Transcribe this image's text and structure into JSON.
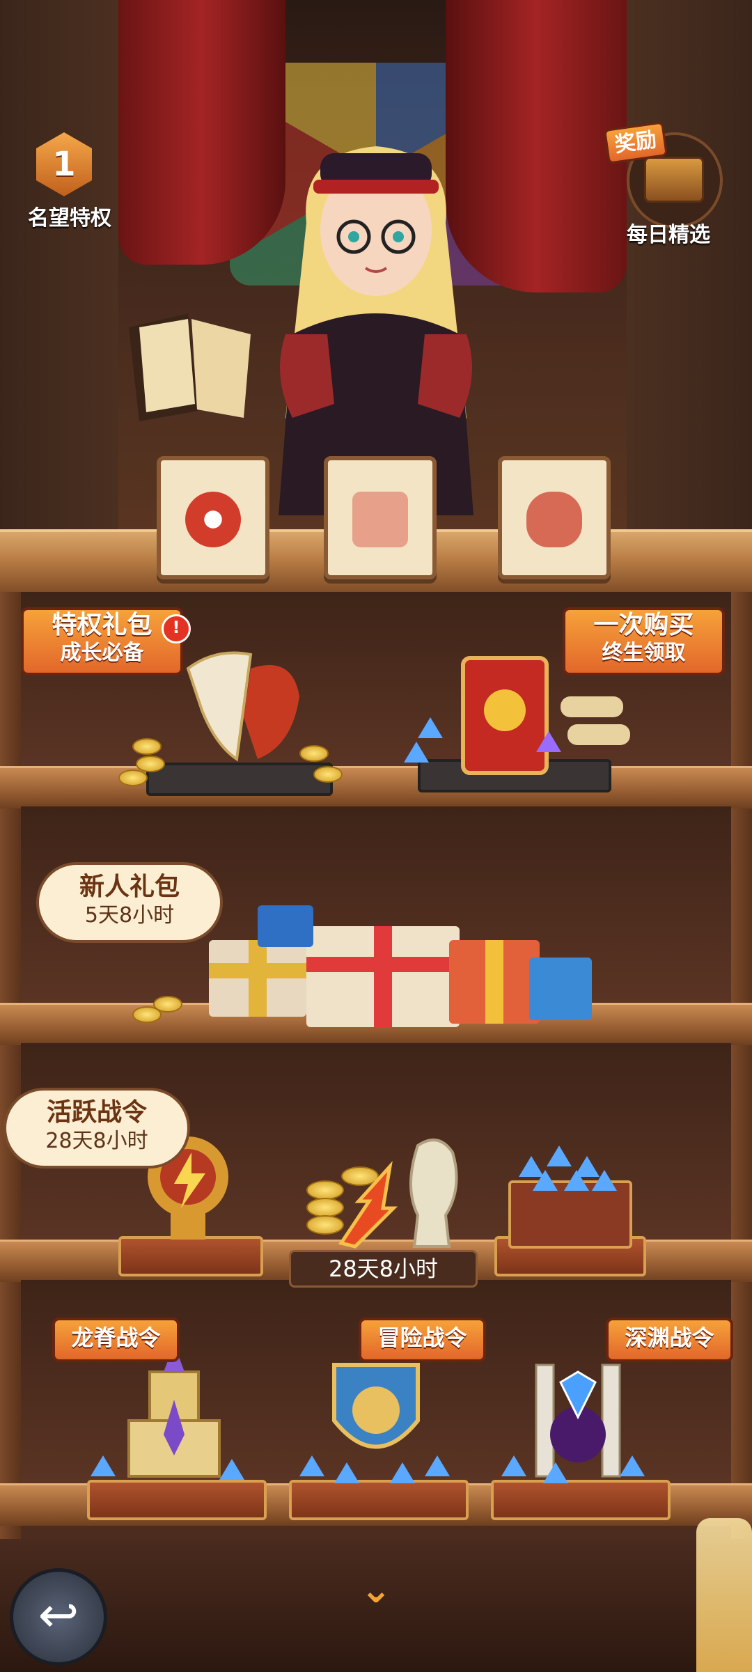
{
  "top": {
    "rank_number": "1",
    "rank_label": "名望特权",
    "daily_reward_tag": "奖励",
    "daily_label": "每日精选"
  },
  "shelf1": {
    "left_tag_title": "特权礼包",
    "left_tag_sub": "成长必备",
    "left_alert": "!",
    "right_tag_title": "一次购买",
    "right_tag_sub": "终生领取"
  },
  "shelf2": {
    "bubble_title": "新人礼包",
    "bubble_timer": "5天8小时"
  },
  "shelf3": {
    "bubble_title": "活跃战令",
    "bubble_timer": "28天8小时",
    "middle_timer": "28天8小时"
  },
  "shelf4": {
    "left_tag": "龙脊战令",
    "middle_tag": "冒险战令",
    "right_tag": "深渊战令"
  },
  "bottom": {
    "back_icon": "↩",
    "chevron": "⌄"
  }
}
